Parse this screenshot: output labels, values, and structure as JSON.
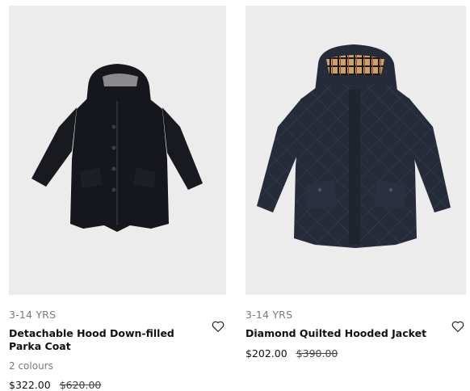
{
  "products": [
    {
      "age": "3-14 YRS",
      "name": "Detachable Hood Down-filled Parka Coat",
      "colours": "2 colours",
      "price": "$322.00",
      "old_price": "$620.00"
    },
    {
      "age": "3-14 YRS",
      "name": "Diamond Quilted Hooded Jacket",
      "price": "$202.00",
      "old_price": "$390.00"
    }
  ],
  "colors": {
    "image_bg": "#ececec",
    "parka": "#15171d",
    "quilted": "#262b3a",
    "check_lining": "#c9a46a"
  }
}
